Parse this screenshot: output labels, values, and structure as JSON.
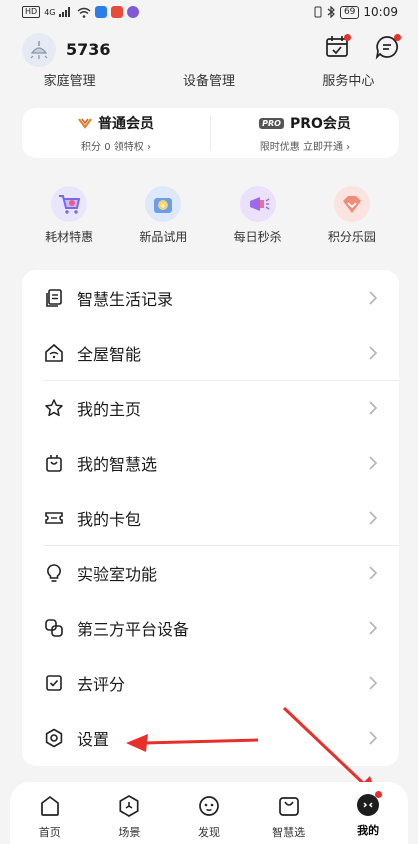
{
  "status_bar": {
    "time": "10:09",
    "battery": "69",
    "network_badge": "HD",
    "signal_text": "4G"
  },
  "profile": {
    "username": "5736"
  },
  "quick_links": [
    "家庭管理",
    "设备管理",
    "服务中心"
  ],
  "membership": {
    "regular": {
      "title": "普通会员",
      "subtitle": "积分 0  领特权 ›"
    },
    "pro": {
      "tag": "PRO",
      "title": "PRO会员",
      "subtitle": "限时优惠 立即开通 ›"
    }
  },
  "promos": [
    {
      "label": "耗材特惠",
      "icon": "cart-icon"
    },
    {
      "label": "新品试用",
      "icon": "trial-bag-icon"
    },
    {
      "label": "每日秒杀",
      "icon": "flash-sale-icon"
    },
    {
      "label": "积分乐园",
      "icon": "diamond-icon"
    }
  ],
  "menu": [
    {
      "label": "智慧生活记录",
      "icon": "document-icon"
    },
    {
      "label": "全屋智能",
      "icon": "smart-home-icon"
    },
    {
      "label": "我的主页",
      "icon": "star-icon"
    },
    {
      "label": "我的智慧选",
      "icon": "shopping-bag-icon"
    },
    {
      "label": "我的卡包",
      "icon": "ticket-icon"
    },
    {
      "label": "实验室功能",
      "icon": "lightbulb-icon"
    },
    {
      "label": "第三方平台设备",
      "icon": "link-icon"
    },
    {
      "label": "去评分",
      "icon": "checkbox-icon"
    },
    {
      "label": "设置",
      "icon": "settings-icon"
    }
  ],
  "tabbar": [
    {
      "label": "首页",
      "icon": "home-icon",
      "active": false
    },
    {
      "label": "场景",
      "icon": "scene-icon",
      "active": false
    },
    {
      "label": "发现",
      "icon": "discover-icon",
      "active": false
    },
    {
      "label": "智慧选",
      "icon": "smart-choice-icon",
      "active": false
    },
    {
      "label": "我的",
      "icon": "profile-icon",
      "active": true
    }
  ],
  "colors": {
    "notification_dot": "#e8302a",
    "annotation_arrow": "#e8302a",
    "background": "#f4f4f5"
  }
}
